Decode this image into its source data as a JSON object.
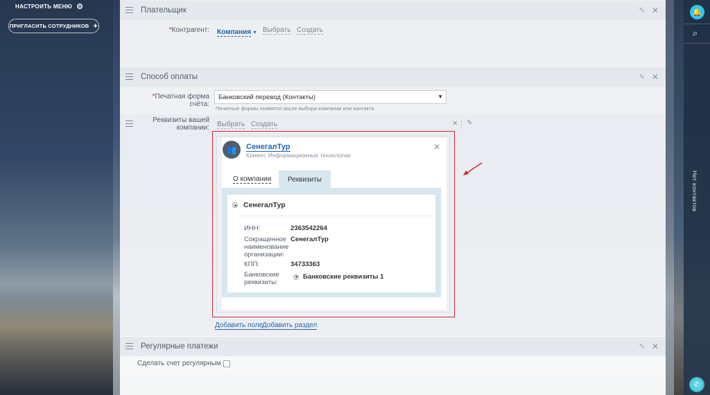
{
  "left_menu": {
    "setup_label": "НАСТРОИТЬ МЕНЮ",
    "invite_label": "ПРИГЛАСИТЬ СОТРУДНИКОВ",
    "invite_plus": "+"
  },
  "sections": {
    "payer": {
      "title": "Плательщик",
      "contractor_required": "*",
      "contractor_label": "Контрагент:",
      "company_link": "Компания",
      "company_caret": "▾",
      "choose": "Выбрать",
      "create": "Создать"
    },
    "payment": {
      "title": "Способ оплаты",
      "print_required": "*",
      "print_label": "Печатная форма счёта:",
      "print_value": "Банковский перевод (Контакты)",
      "print_hint": "Печатные формы появятся после выбора компании или контакта",
      "requisites_label_1": "Реквизиты вашей",
      "requisites_label_2": "компании:",
      "choose": "Выбрать",
      "create": "Создать",
      "add_field": "Добавить поле",
      "add_section": "Добавить раздел"
    },
    "regular": {
      "title": "Регулярные платежи",
      "make_regular": "Сделать счет регулярным"
    }
  },
  "popup": {
    "company_name": "СенегалТур",
    "company_sub": "Клиент, Информационные технологии",
    "tab_about": "О компании",
    "tab_requisites": "Реквизиты",
    "card_title": "СенегалТур",
    "rows": [
      {
        "label": "ИНН:",
        "value": "2363542264"
      },
      {
        "label": "Сокращенное наименование организации:",
        "value": "СенегалТур"
      },
      {
        "label": "КПП:",
        "value": "34733363"
      },
      {
        "label": "Банковские реквизиты:",
        "value": "Банковские реквизиты 1"
      }
    ]
  },
  "right_rail": {
    "vertical_text": "Нет контактов"
  },
  "colors": {
    "accent_blue": "#2067b0",
    "highlight_red": "#d8242e",
    "bell_blue": "#2fc6f6"
  },
  "icons": [
    "gear-icon",
    "hamburger-icon",
    "pencil-icon",
    "close-icon",
    "avatar-icon",
    "bell-icon",
    "search-icon",
    "phone-icon",
    "red-arrow-icon"
  ]
}
